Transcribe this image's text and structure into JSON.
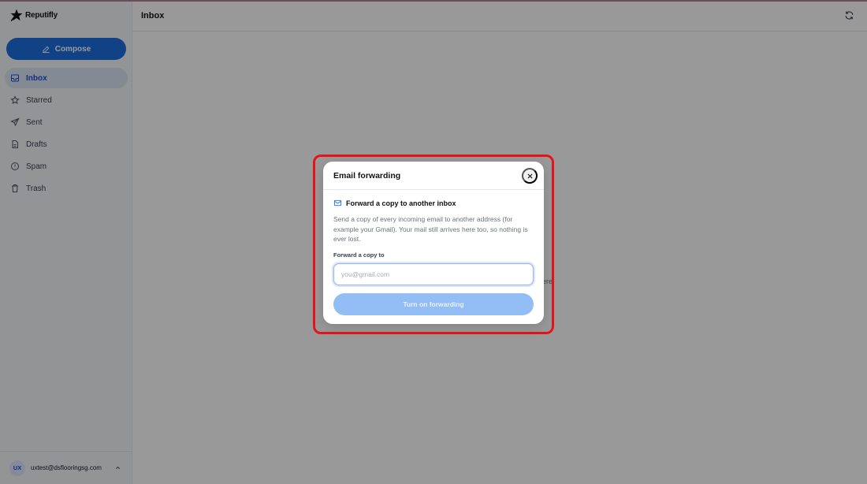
{
  "app": {
    "name": "Reputifly",
    "brand_color": "#1d6fe0"
  },
  "sidebar": {
    "compose_label": "Compose",
    "items": [
      {
        "label": "Inbox",
        "icon": "inbox-icon",
        "active": true
      },
      {
        "label": "Starred",
        "icon": "star-icon",
        "active": false
      },
      {
        "label": "Sent",
        "icon": "send-icon",
        "active": false
      },
      {
        "label": "Drafts",
        "icon": "file-icon",
        "active": false
      },
      {
        "label": "Spam",
        "icon": "alert-circle-icon",
        "active": false
      },
      {
        "label": "Trash",
        "icon": "trash-icon",
        "active": false
      }
    ],
    "user": {
      "initials": "UX",
      "email": "uxtest@dsflooringsg.com"
    }
  },
  "main": {
    "title": "Inbox",
    "empty_text_fragment": "ere."
  },
  "modal": {
    "title": "Email forwarding",
    "section_title": "Forward a copy to another inbox",
    "description": "Send a copy of every incoming email to another address (for example your Gmail). Your mail still arrives here too, so nothing is ever lost.",
    "field_label": "Forward a copy to",
    "input_value": "",
    "input_placeholder": "you@gmail.com",
    "submit_label": "Turn on forwarding"
  },
  "colors": {
    "highlight": "#e5141b",
    "active_nav_bg": "#dbe7f7",
    "submit_disabled": "#93bdf5"
  }
}
